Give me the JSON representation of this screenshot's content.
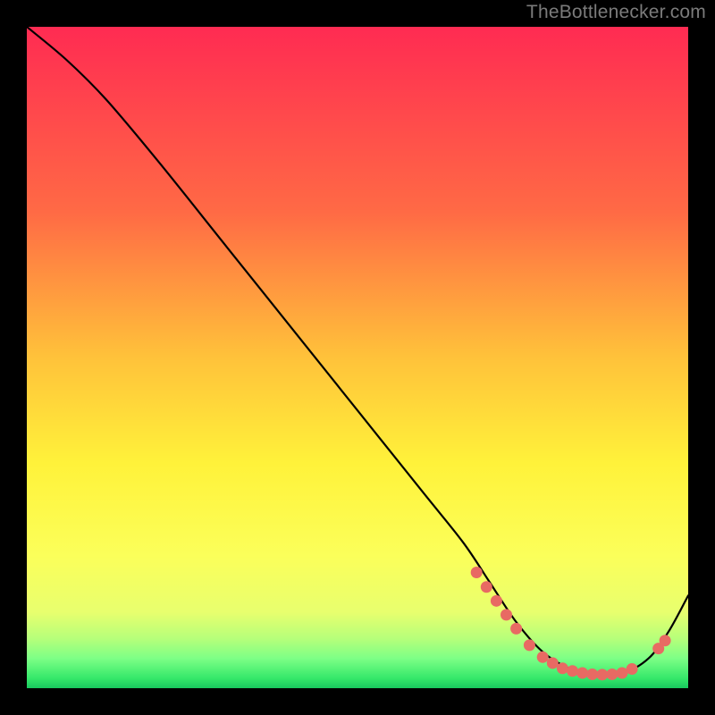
{
  "attribution": "TheBottlenecker.com",
  "colors": {
    "bg": "#000000",
    "attribution": "#7b7b7b",
    "curve": "#000000",
    "dots": "#e86a63",
    "gradient_top": "#ff2b52",
    "gradient_mid1": "#ff8a3a",
    "gradient_mid2": "#ffe43a",
    "gradient_mid3": "#fbff5a",
    "gradient_low1": "#c8ff7a",
    "gradient_low2": "#6fff8a",
    "gradient_bottom": "#18e05e"
  },
  "chart_data": {
    "type": "line",
    "title": "",
    "xlabel": "",
    "ylabel": "",
    "xlim": [
      0,
      100
    ],
    "ylim": [
      0,
      100
    ],
    "series": [
      {
        "name": "curve",
        "x": [
          0,
          6,
          12,
          20,
          30,
          40,
          50,
          60,
          66,
          70,
          74,
          78,
          82,
          86,
          90,
          94,
          97,
          100
        ],
        "y": [
          100,
          95,
          89,
          79.5,
          67,
          54.5,
          42,
          29.5,
          22,
          16,
          10,
          5.5,
          3,
          2,
          2.2,
          4.5,
          8.5,
          14
        ]
      }
    ],
    "scatter": [
      {
        "x": 68,
        "y": 17.5
      },
      {
        "x": 69.5,
        "y": 15.3
      },
      {
        "x": 71,
        "y": 13.2
      },
      {
        "x": 72.5,
        "y": 11.1
      },
      {
        "x": 74,
        "y": 9.0
      },
      {
        "x": 76,
        "y": 6.5
      },
      {
        "x": 78,
        "y": 4.7
      },
      {
        "x": 79.5,
        "y": 3.8
      },
      {
        "x": 81,
        "y": 3.0
      },
      {
        "x": 82.5,
        "y": 2.6
      },
      {
        "x": 84,
        "y": 2.3
      },
      {
        "x": 85.5,
        "y": 2.1
      },
      {
        "x": 87,
        "y": 2.05
      },
      {
        "x": 88.5,
        "y": 2.1
      },
      {
        "x": 90,
        "y": 2.3
      },
      {
        "x": 91.5,
        "y": 2.9
      },
      {
        "x": 95.5,
        "y": 6.0
      },
      {
        "x": 96.5,
        "y": 7.2
      }
    ],
    "gradient_stops_vertical": [
      {
        "pos": 0.0,
        "color": "#ff2b52"
      },
      {
        "pos": 0.28,
        "color": "#ff6a45"
      },
      {
        "pos": 0.5,
        "color": "#ffc23a"
      },
      {
        "pos": 0.66,
        "color": "#fff23a"
      },
      {
        "pos": 0.8,
        "color": "#fbff5a"
      },
      {
        "pos": 0.885,
        "color": "#e8ff6e"
      },
      {
        "pos": 0.925,
        "color": "#b6ff7a"
      },
      {
        "pos": 0.955,
        "color": "#7dff86"
      },
      {
        "pos": 0.985,
        "color": "#35e86a"
      },
      {
        "pos": 1.0,
        "color": "#18c85e"
      }
    ]
  }
}
